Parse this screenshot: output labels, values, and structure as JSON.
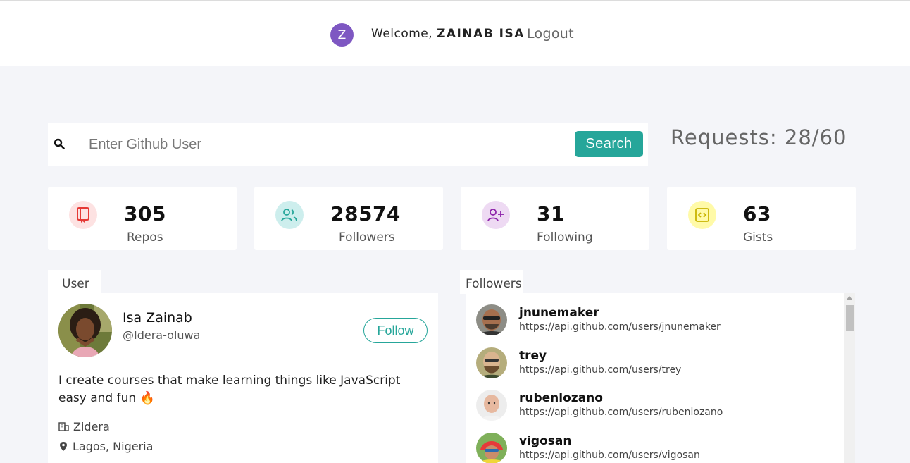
{
  "header": {
    "avatar_letter": "Z",
    "welcome_prefix": "Welcome,",
    "user_name": "ZAINAB ISA",
    "logout_label": "Logout",
    "avatar_color": "#7e57c2"
  },
  "search": {
    "placeholder": "Enter Github User",
    "value": "",
    "button_label": "Search",
    "button_color": "#26a69a",
    "icon": "search-icon"
  },
  "requests": {
    "label": "Requests:",
    "value": "28/60"
  },
  "stats": [
    {
      "value": "305",
      "label": "Repos",
      "icon": "repo-book-icon",
      "color": "#e53935",
      "bg": "#fde2e2"
    },
    {
      "value": "28574",
      "label": "Followers",
      "icon": "users-icon",
      "color": "#26a69a",
      "bg": "#cdeeed"
    },
    {
      "value": "31",
      "label": "Following",
      "icon": "user-plus-icon",
      "color": "#8e24aa",
      "bg": "#eedaf3"
    },
    {
      "value": "63",
      "label": "Gists",
      "icon": "code-icon",
      "color": "#c8b400",
      "bg": "#fffaa8"
    }
  ],
  "user": {
    "tab_label": "User",
    "name": "Isa Zainab",
    "login": "@Idera-oluwa",
    "follow_label": "Follow",
    "bio": "I create courses that make learning things like JavaScript easy and fun 🔥",
    "company": "Zidera",
    "location": "Lagos, Nigeria"
  },
  "followers": {
    "tab_label": "Followers",
    "items": [
      {
        "login": "jnunemaker",
        "url": "https://api.github.com/users/jnunemaker"
      },
      {
        "login": "trey",
        "url": "https://api.github.com/users/trey"
      },
      {
        "login": "rubenlozano",
        "url": "https://api.github.com/users/rubenlozano"
      },
      {
        "login": "vigosan",
        "url": "https://api.github.com/users/vigosan"
      }
    ]
  }
}
